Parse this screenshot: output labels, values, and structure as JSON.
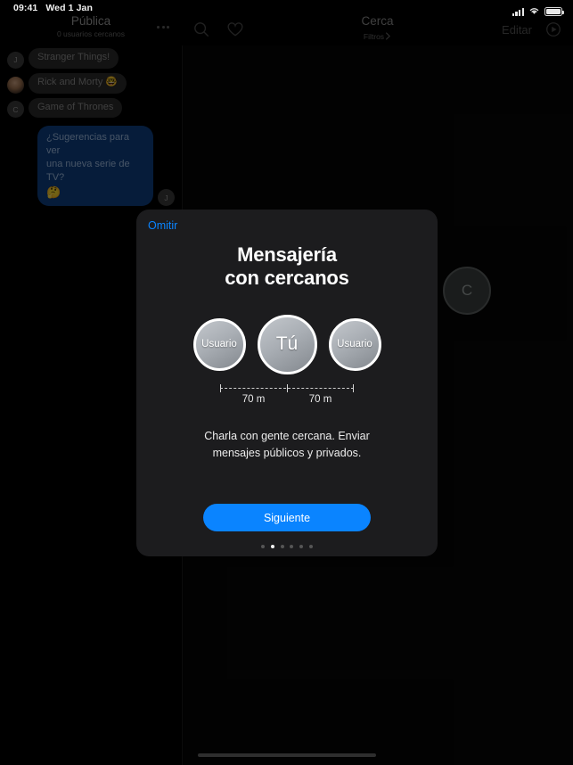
{
  "status_bar": {
    "time": "09:41",
    "date": "Wed 1 Jan",
    "cellular_icon": "signal-bars-icon",
    "wifi_icon": "wifi-icon",
    "battery_icon": "battery-icon"
  },
  "left_header": {
    "title": "Pública",
    "subtitle": "0 usuarios cercanos",
    "more_icon": "more-options-icon"
  },
  "right_header": {
    "search_icon": "search-icon",
    "heart_icon": "heart-icon",
    "title": "Cerca",
    "filters_label": "Filtros",
    "filters_chevron": "chevron-right-icon",
    "edit_label": "Editar",
    "broadcast_icon": "broadcast-play-icon"
  },
  "chat": {
    "messages": [
      {
        "avatar": "J",
        "avatar_type": "initial",
        "text": "Stranger Things!",
        "outgoing": false
      },
      {
        "avatar": "",
        "avatar_type": "photo",
        "text": "Rick and Morty 🤓",
        "outgoing": false
      },
      {
        "avatar": "C",
        "avatar_type": "initial",
        "text": "Game of Thrones",
        "outgoing": false
      }
    ],
    "outgoing": {
      "avatar": "J",
      "line1": "¿Sugerencias para ver",
      "line2": "una nueva serie de TV?",
      "emoji": "🤔"
    }
  },
  "map": {
    "pin_label": "C"
  },
  "modal": {
    "skip_label": "Omitir",
    "title_line1": "Mensajería",
    "title_line2": "con cercanos",
    "diagram": {
      "left_label": "Usuario",
      "center_label": "Tú",
      "right_label": "Usuario",
      "distance_left": "70 m",
      "distance_right": "70 m"
    },
    "description_line1": "Charla con gente cercana.",
    "description_line2": "Enviar mensajes públicos y",
    "description_line3": "privados.",
    "button_label": "Siguiente",
    "page_total": 6,
    "page_active": 2
  },
  "colors": {
    "accent_blue": "#0a84ff",
    "modal_bg": "#1c1c1e",
    "bubble_in": "#2a2a2a",
    "bubble_out": "#0f3f82"
  },
  "home_indicator": "home-indicator"
}
